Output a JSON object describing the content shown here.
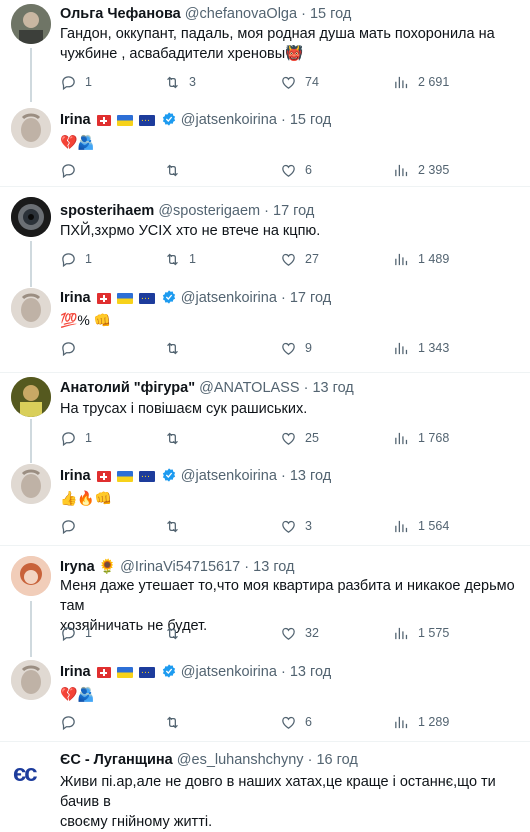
{
  "tweets": [
    {
      "name": "Ольга Чефанова",
      "handle": "@chefanovaOlga",
      "time": "15 год",
      "lines": [
        "Гандон, оккупант, падаль, моя родная душа мать похоронила на",
        "чужбине , асвабадители хреновы👹"
      ],
      "reply": "1",
      "rt": "3",
      "like": "74",
      "views": "2 691"
    },
    {
      "name": "Irina",
      "handle": "@jatsenkoirina",
      "time": "15 год",
      "lines": [
        "💔🫂"
      ],
      "reply": "",
      "rt": "",
      "like": "6",
      "views": "2 395"
    },
    {
      "name": "sposterihaem",
      "handle": "@sposterigaem",
      "time": "17 год",
      "lines": [
        "ПХЙ,зхрмо УСІХ хто не втече на кцпю."
      ],
      "reply": "1",
      "rt": "1",
      "like": "27",
      "views": "1 489"
    },
    {
      "name": "Irina",
      "handle": "@jatsenkoirina",
      "time": "17 год",
      "lines": [
        "💯% 👊"
      ],
      "reply": "",
      "rt": "",
      "like": "9",
      "views": "1 343"
    },
    {
      "name": "Анатолий \"фігура\"",
      "handle": "@ANATOLASS",
      "time": "13 год",
      "lines": [
        "На трусах і повішаєм сук рашиських."
      ],
      "reply": "1",
      "rt": "",
      "like": "25",
      "views": "1 768"
    },
    {
      "name": "Irina",
      "handle": "@jatsenkoirina",
      "time": "13 год",
      "lines": [
        "👍🔥👊"
      ],
      "reply": "",
      "rt": "",
      "like": "3",
      "views": "1 564"
    },
    {
      "name": "Iryna",
      "handle": "@IrinaVi54715617",
      "time": "13 год",
      "lines": [
        "Меня даже утешает то,что моя квартира разбита и никакое дерьмо там",
        "хозяйничать не будет."
      ],
      "reply": "1",
      "rt": "",
      "like": "32",
      "views": "1 575"
    },
    {
      "name": "Irina",
      "handle": "@jatsenkoirina",
      "time": "13 год",
      "lines": [
        "💔🫂"
      ],
      "reply": "",
      "rt": "",
      "like": "6",
      "views": "1 289"
    },
    {
      "name": "ЄС - Луганщина",
      "handle": "@es_luhanshchyny",
      "time": "16 год",
      "lines": [
        "Живи пі.ар,але не довго в наших хатах,це краще і останнє,що ти бачив в",
        "своєму гнійному житті."
      ]
    }
  ],
  "dot": "·",
  "sunflower": "🌻",
  "es_logo": "єс",
  "colors": {
    "text": "#0f1419",
    "muted": "#536471",
    "separator": "#eff3f4",
    "thread": "#cfd9de",
    "verified": "#1d9bf0",
    "es_blue": "#1d3c9c",
    "es_yellow": "#f7d21a"
  }
}
